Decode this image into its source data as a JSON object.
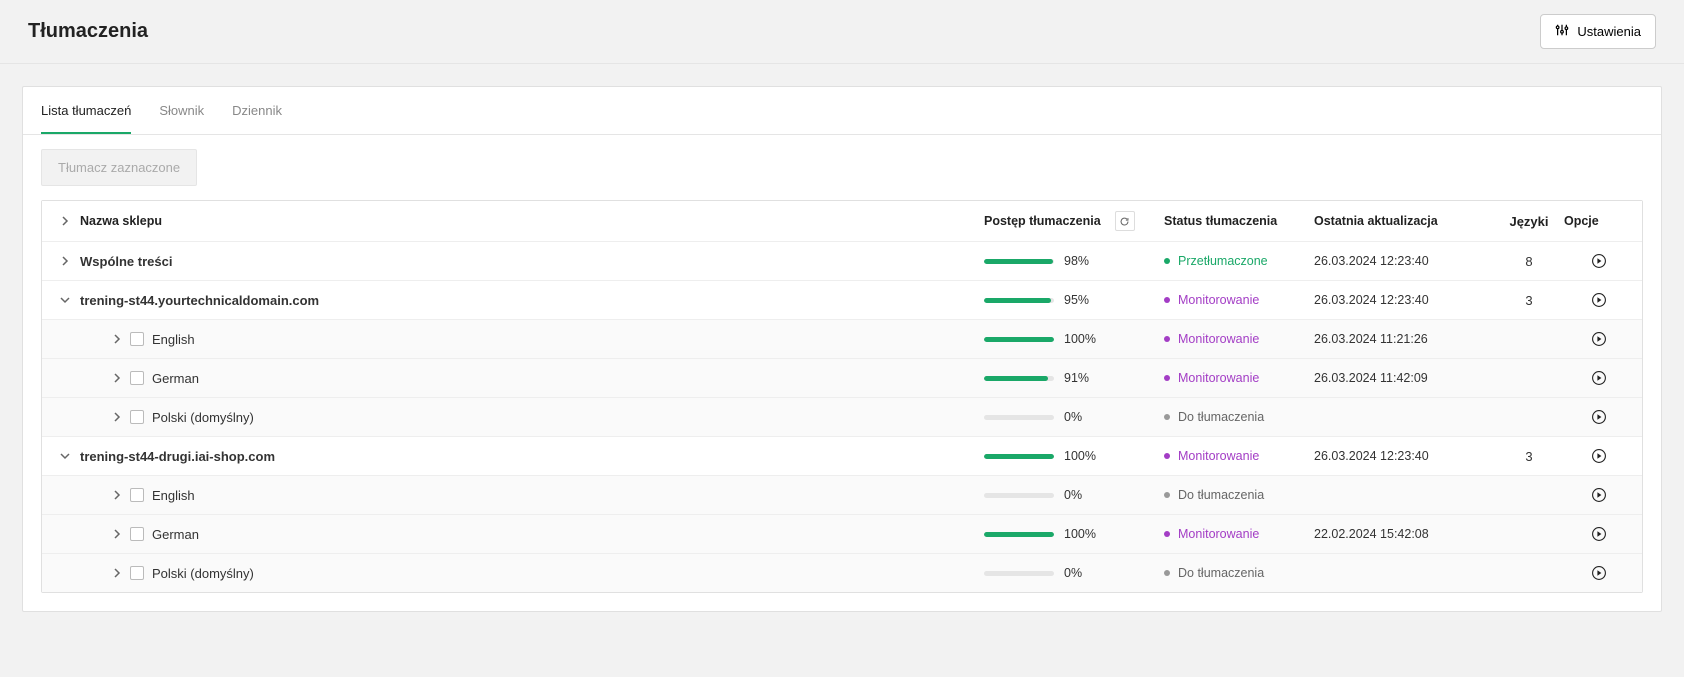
{
  "header": {
    "title": "Tłumaczenia",
    "settings_label": "Ustawienia"
  },
  "tabs": {
    "list": "Lista tłumaczeń",
    "dictionary": "Słownik",
    "journal": "Dziennik"
  },
  "toolbar": {
    "translate_selected": "Tłumacz zaznaczone"
  },
  "columns": {
    "name": "Nazwa sklepu",
    "progress": "Postęp tłumaczenia",
    "status": "Status tłumaczenia",
    "updated": "Ostatnia aktualizacja",
    "langs": "Języki",
    "options": "Opcje"
  },
  "status_labels": {
    "translated": "Przetłumaczone",
    "monitoring": "Monitorowanie",
    "to_translate": "Do tłumaczenia"
  },
  "rows": [
    {
      "type": "parent",
      "expand": "right",
      "name": "Wspólne treści",
      "progress": 98,
      "status": "translated",
      "updated": "26.03.2024 12:23:40",
      "langs": "8"
    },
    {
      "type": "parent",
      "expand": "down",
      "name": "trening-st44.yourtechnicaldomain.com",
      "progress": 95,
      "status": "monitoring",
      "updated": "26.03.2024 12:23:40",
      "langs": "3"
    },
    {
      "type": "child",
      "name": "English",
      "progress": 100,
      "status": "monitoring",
      "updated": "26.03.2024 11:21:26"
    },
    {
      "type": "child",
      "name": "German",
      "progress": 91,
      "status": "monitoring",
      "updated": "26.03.2024 11:42:09"
    },
    {
      "type": "child",
      "name": "Polski (domyślny)",
      "progress": 0,
      "status": "to_translate",
      "updated": ""
    },
    {
      "type": "parent",
      "expand": "down",
      "name": "trening-st44-drugi.iai-shop.com",
      "progress": 100,
      "status": "monitoring",
      "updated": "26.03.2024 12:23:40",
      "langs": "3"
    },
    {
      "type": "child",
      "name": "English",
      "progress": 0,
      "status": "to_translate",
      "updated": ""
    },
    {
      "type": "child",
      "name": "German",
      "progress": 100,
      "status": "monitoring",
      "updated": "22.02.2024 15:42:08"
    },
    {
      "type": "child",
      "name": "Polski (domyślny)",
      "progress": 0,
      "status": "to_translate",
      "updated": ""
    }
  ]
}
